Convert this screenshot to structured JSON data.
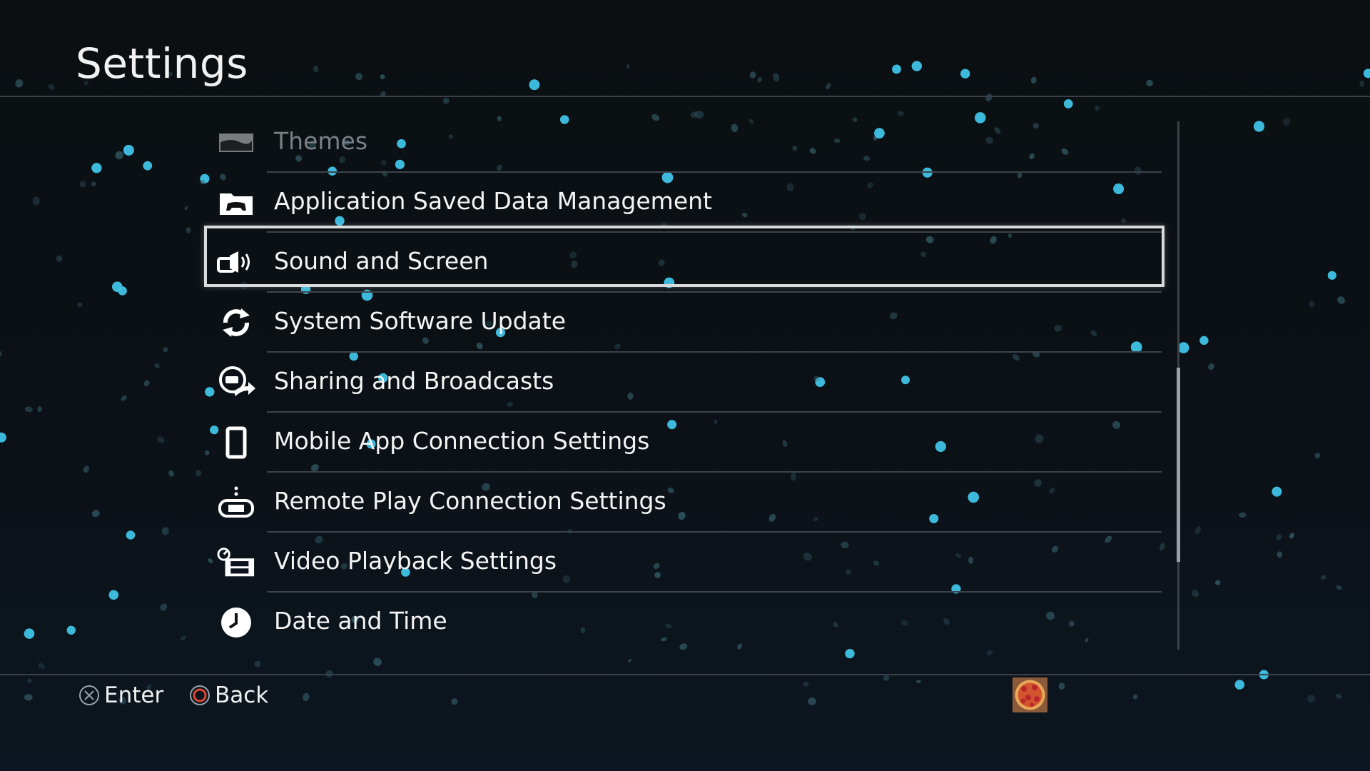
{
  "header": {
    "title": "Settings"
  },
  "menu": {
    "items": [
      {
        "label": "Themes",
        "icon": "themes-icon",
        "state": "dim"
      },
      {
        "label": "Application Saved Data Management",
        "icon": "saved-data-folder-icon"
      },
      {
        "label": "Sound and Screen",
        "icon": "sound-screen-icon",
        "state": "selected"
      },
      {
        "label": "System Software Update",
        "icon": "update-arrows-icon"
      },
      {
        "label": "Sharing and Broadcasts",
        "icon": "share-broadcast-icon"
      },
      {
        "label": "Mobile App Connection Settings",
        "icon": "mobile-phone-icon"
      },
      {
        "label": "Remote Play Connection Settings",
        "icon": "remote-play-icon"
      },
      {
        "label": "Video Playback Settings",
        "icon": "video-playback-icon"
      },
      {
        "label": "Date and Time",
        "icon": "clock-icon"
      }
    ]
  },
  "footer": {
    "enter_label": "Enter",
    "back_label": "Back",
    "enter_icon": "cross-button-icon",
    "back_icon": "circle-button-icon",
    "avatar_icon": "pizza-avatar-icon"
  },
  "colors": {
    "background": "#0b1116",
    "accent_particle": "#3fc3e6",
    "selection_border": "#d9dadb",
    "back_button": "#e0482e"
  }
}
